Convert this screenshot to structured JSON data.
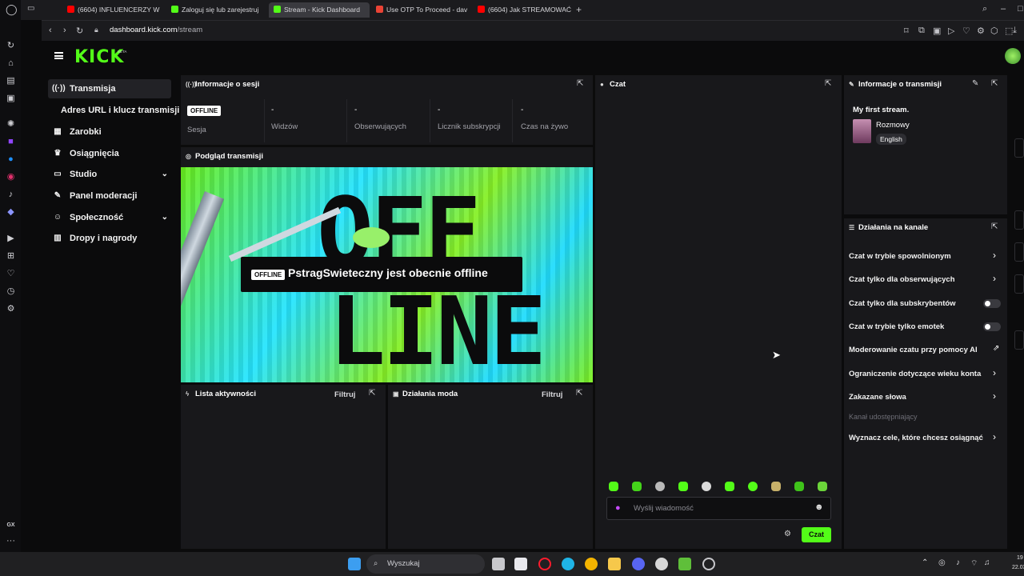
{
  "browser": {
    "tabs": [
      {
        "label": "(6604) INFLUENCERZY W",
        "favicon": "youtube-icon",
        "color": "#ff0000"
      },
      {
        "label": "Zaloguj się lub zarejestruj",
        "favicon": "kick-icon",
        "color": "#53fc18"
      },
      {
        "label": "Stream - Kick Dashboard",
        "favicon": "kick-icon",
        "color": "#53fc18"
      },
      {
        "label": "Use OTP To Proceed - dav",
        "favicon": "gmail-icon",
        "color": "#ea4335"
      },
      {
        "label": "(6604) Jak STREAMOWAĆ",
        "favicon": "youtube-icon",
        "color": "#ff0000"
      }
    ],
    "url_host": "dashboard.kick.com",
    "url_path": "/stream"
  },
  "logo": {
    "text": "KICK",
    "badge": "BETA"
  },
  "sidebar": {
    "items": [
      {
        "label": "Transmisja",
        "icon": "broadcast-icon",
        "active": true
      },
      {
        "label": "Adres URL i klucz transmisji",
        "icon": "",
        "active": false
      },
      {
        "label": "Zarobki",
        "icon": "wallet-icon",
        "active": false
      },
      {
        "label": "Osiągnięcia",
        "icon": "trophy-icon",
        "active": false
      },
      {
        "label": "Studio",
        "icon": "studio-icon",
        "active": false
      },
      {
        "label": "Panel moderacji",
        "icon": "wrench-icon",
        "active": false
      },
      {
        "label": "Społeczność",
        "icon": "community-icon",
        "active": false
      },
      {
        "label": "Dropy i nagrody",
        "icon": "gift-icon",
        "active": false
      }
    ]
  },
  "session": {
    "title": "Informacje o sesji",
    "badge": "OFFLINE",
    "stats": [
      {
        "value": "",
        "label": "Sesja"
      },
      {
        "value": "-",
        "label": "Widzów"
      },
      {
        "value": "-",
        "label": "Obserwujących"
      },
      {
        "value": "-",
        "label": "Licznik subskrypcji"
      },
      {
        "value": "-",
        "label": "Czas na żywo"
      }
    ]
  },
  "preview": {
    "title": "Podgląd transmisji",
    "badge": "OFFLINE",
    "message": "PstragSwieteczny jest obecnie offline",
    "art_top": "OFF",
    "art_bottom": "LINE"
  },
  "activity": {
    "title": "Lista aktywności",
    "filter": "Filtruj"
  },
  "modactions": {
    "title": "Działania moda",
    "filter": "Filtruj"
  },
  "chat": {
    "title": "Czat",
    "placeholder": "Wyślij wiadomość",
    "send": "Czat"
  },
  "streaminfo": {
    "title": "Informacje o transmisji",
    "stream_title": "My first stream.",
    "category": "Rozmowy",
    "language": "English"
  },
  "channel": {
    "title": "Działania na kanale",
    "rows": [
      {
        "label": "Czat w trybie spowolnionym",
        "control": "arrow"
      },
      {
        "label": "Czat tylko dla obserwujących",
        "control": "arrow"
      },
      {
        "label": "Czat tylko dla subskrybentów",
        "control": "toggle"
      },
      {
        "label": "Czat w trybie tylko emotek",
        "control": "toggle"
      },
      {
        "label": "Moderowanie czatu przy pomocy AI",
        "control": "external"
      },
      {
        "label": "Ograniczenie dotyczące wieku konta",
        "control": "arrow"
      },
      {
        "label": "Zakazane słowa",
        "control": "arrow"
      }
    ],
    "section": "Kanał udostępniający",
    "goal": "Wyznacz cele, które chcesz osiągnąć"
  },
  "taskbar": {
    "search": "Wyszukaj",
    "clock": "19",
    "date": "22.03.2"
  },
  "gx": {
    "label": "GX"
  }
}
